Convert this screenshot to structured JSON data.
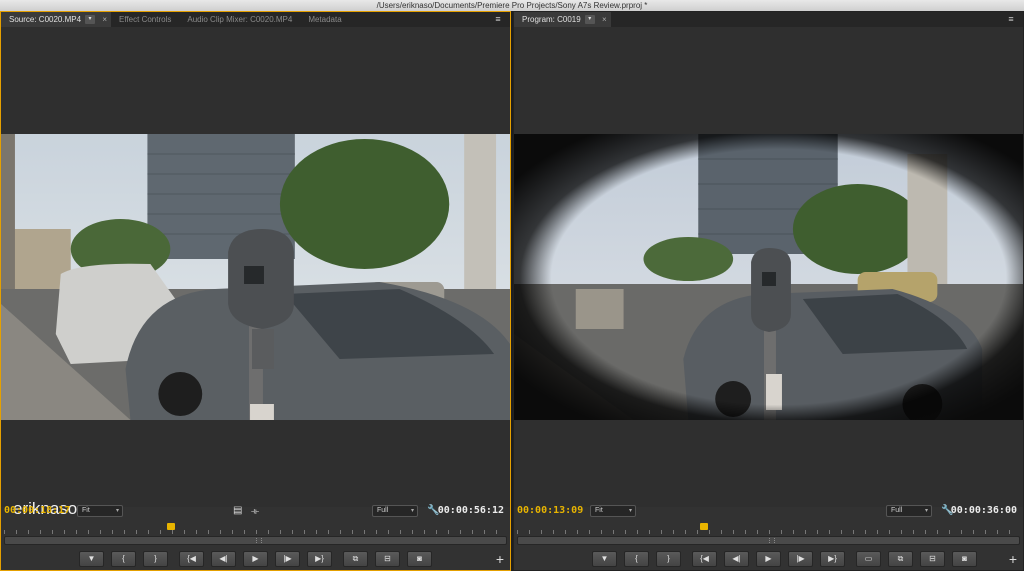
{
  "window": {
    "title": "/Users/eriknaso/Documents/Premiere Pro Projects/Sony A7s Review.prproj *"
  },
  "source_panel": {
    "tabs": [
      {
        "label": "Source: C0020.MP4",
        "active": true
      },
      {
        "label": "Effect Controls"
      },
      {
        "label": "Audio Clip Mixer: C0020.MP4"
      },
      {
        "label": "Metadata"
      }
    ],
    "watermark": "eriknaso.com",
    "current_timecode": "00:00:18:17",
    "duration_timecode": "00:00:56:12",
    "zoom": "Fit",
    "resolution": "Full",
    "playhead_fraction": 0.33
  },
  "program_panel": {
    "tabs": [
      {
        "label": "Program: C0019",
        "active": true
      }
    ],
    "current_timecode": "00:00:13:09",
    "duration_timecode": "00:00:36:00",
    "zoom": "Fit",
    "resolution": "Full",
    "playhead_fraction": 0.37
  },
  "icons": {
    "marker": "marker-icon",
    "mark_in": "mark-in-icon",
    "mark_out": "mark-out-icon",
    "go_in": "go-to-in-icon",
    "step_back": "step-back-icon",
    "play": "play-icon",
    "step_fwd": "step-forward-icon",
    "go_out": "go-to-out-icon",
    "insert": "insert-icon",
    "overwrite": "overwrite-icon",
    "lift": "lift-icon",
    "extract": "extract-icon",
    "export_frame": "export-frame-icon",
    "safe_margins": "safe-margins-icon",
    "add": "plus-icon",
    "settings": "wrench-icon",
    "drag_video": "drag-video-icon",
    "drag_audio": "drag-audio-icon"
  },
  "colors": {
    "accent": "#e5a000",
    "timecode": "#e8b400",
    "panel": "#323232"
  }
}
